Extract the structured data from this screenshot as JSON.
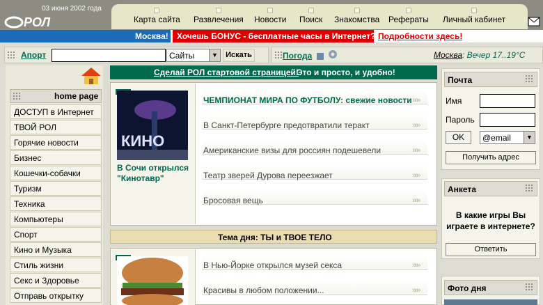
{
  "header": {
    "date": "03 июня 2002 года",
    "logo_text": "РОЛ",
    "menu": [
      "Карта сайта",
      "Развлечения",
      "Новости",
      "Поиск",
      "Знакомства",
      "Рефераты",
      "Личный кабинет"
    ]
  },
  "banner": {
    "city": "Москва!",
    "bonus": "Хочешь БОНУС - бесплатные часы в Интернет?",
    "details": "Подробности здесь!"
  },
  "search": {
    "aport": "Апорт",
    "value": "",
    "scope": "Сайты",
    "button": "Искать"
  },
  "weather": {
    "link": "Погода",
    "city": "Москва",
    "text": ": Вечер 17..19°С"
  },
  "leftnav": {
    "home": "home page",
    "items": [
      "ДОСТУП в Интернет",
      "ТВОЙ РОЛ",
      "Горячие новости",
      "Бизнес",
      "Кошечки-собачки",
      "Туризм",
      "Техника",
      "Компьютеры",
      "Спорт",
      "Кино и Музыка",
      "Стиль жизни",
      "Секс и Здоровье",
      "Отправь открытку"
    ]
  },
  "promo": {
    "link": "Сделай РОЛ стартовой страницей!",
    "text": "Это и просто, и удобно!"
  },
  "news": {
    "photo_caption": "В Сочи открылся \"Кинотавр\"",
    "photo_text": "КИНО",
    "headlines": [
      "ЧЕМПИОНАТ МИРА ПО ФУТБОЛУ: свежие новости",
      "В Санкт-Петербурге предотвратили теракт",
      "Американские визы для россиян подешевели",
      "Театр зверей Дурова переезжает",
      "Бросовая вещь"
    ]
  },
  "topic": {
    "title": "Тема дня: ТЫ и ТВОЕ ТЕЛО",
    "headlines": [
      "В Нью-Йорке открылся музей секса",
      "Красивы в любом положении..."
    ]
  },
  "mail": {
    "title": "Почта",
    "name_label": "Имя",
    "password_label": "Пароль",
    "ok": "OK",
    "domain": "@email",
    "get_address": "Получить адрес"
  },
  "poll": {
    "title": "Анкета",
    "question": "В какие игры Вы играете в интернете?",
    "answer": "Ответить"
  },
  "photo_day": {
    "title": "Фото дня"
  },
  "colors": {
    "accent_green": "#006a4e",
    "banner_red": "#e00000",
    "banner_blue": "#1a6cb4"
  }
}
